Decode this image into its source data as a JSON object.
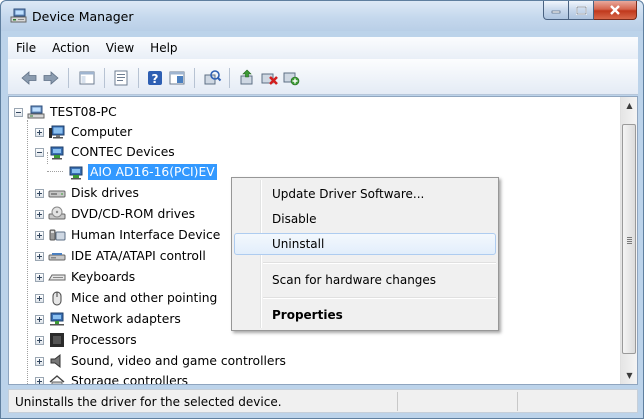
{
  "window": {
    "title": "Device Manager",
    "caption_buttons": [
      "minimize",
      "maximize",
      "close"
    ]
  },
  "menubar": {
    "items": [
      "File",
      "Action",
      "View",
      "Help"
    ]
  },
  "toolbar": {
    "buttons": [
      "back-icon",
      "forward-icon",
      "show-hide-console-tree-icon",
      "properties-icon",
      "help-icon",
      "view-icon",
      "scan-hardware-icon",
      "update-driver-icon",
      "uninstall-icon",
      "disable-icon"
    ]
  },
  "tree": {
    "root": "TEST08-PC",
    "nodes": [
      {
        "label": "Computer",
        "expanded": false
      },
      {
        "label": "CONTEC Devices",
        "expanded": true
      },
      {
        "label": "AIO AD16-16(PCI)EV",
        "selected": true
      },
      {
        "label": "Disk drives",
        "expanded": false
      },
      {
        "label": "DVD/CD-ROM drives",
        "expanded": false
      },
      {
        "label": "Human Interface Device",
        "expanded": false
      },
      {
        "label": "IDE ATA/ATAPI controll",
        "expanded": false
      },
      {
        "label": "Keyboards",
        "expanded": false
      },
      {
        "label": "Mice and other pointing",
        "expanded": false
      },
      {
        "label": "Network adapters",
        "expanded": false
      },
      {
        "label": "Processors",
        "expanded": false
      },
      {
        "label": "Sound, video and game controllers",
        "expanded": false
      },
      {
        "label": "Storage controllers",
        "expanded": false
      }
    ]
  },
  "context_menu": {
    "items": [
      {
        "label": "Update Driver Software..."
      },
      {
        "label": "Disable"
      },
      {
        "label": "Uninstall",
        "hover": true
      },
      {
        "label": "Scan for hardware changes"
      },
      {
        "label": "Properties",
        "bold": true
      }
    ]
  },
  "status": {
    "text": "Uninstalls the driver for the selected device."
  }
}
